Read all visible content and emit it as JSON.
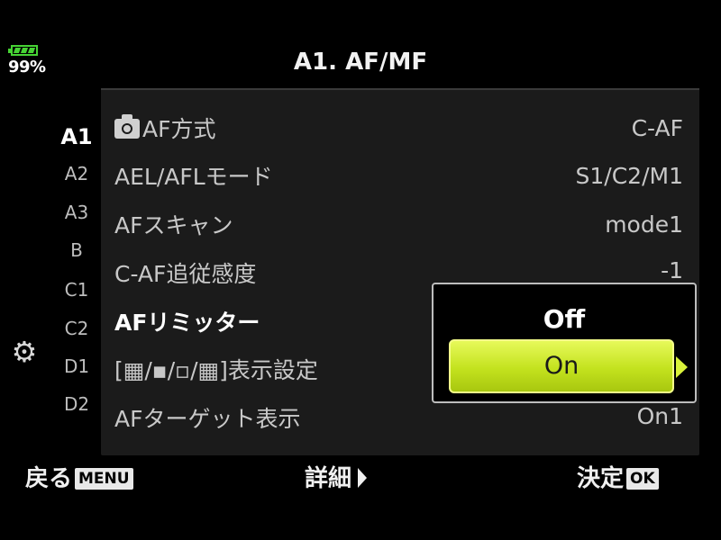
{
  "status": {
    "battery_percent": "99%"
  },
  "header": {
    "title": "A1. AF/MF"
  },
  "tabs": [
    "A1",
    "A2",
    "A3",
    "B",
    "C1",
    "C2",
    "D1",
    "D2"
  ],
  "active_tab": "A1",
  "settings_icon": "gear-icon",
  "rows": [
    {
      "label": "AF方式",
      "value": "C-AF",
      "icon": "camera-icon"
    },
    {
      "label": "AEL/AFLモード",
      "value": "S1/C2/M1"
    },
    {
      "label": "AFスキャン",
      "value": "mode1"
    },
    {
      "label": "C-AF追従感度",
      "value": "-1"
    },
    {
      "label": "AFリミッター",
      "value": "",
      "selected": true
    },
    {
      "label": "[▦/▪/▫/▦]表示設定",
      "value": ""
    },
    {
      "label": "AFターゲット表示",
      "value": "On1"
    }
  ],
  "popup": {
    "options": [
      "Off",
      "On"
    ],
    "highlighted": "On",
    "highlight_color": "#c3e21e"
  },
  "footer": {
    "back_label": "戻る",
    "back_badge": "MENU",
    "detail_label": "詳細",
    "ok_label": "決定",
    "ok_badge": "OK"
  }
}
